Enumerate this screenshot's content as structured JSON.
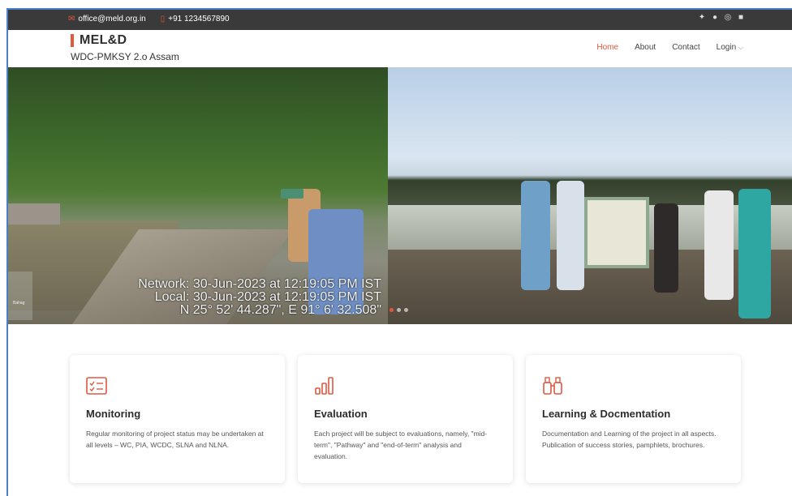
{
  "topbar": {
    "email": "office@meld.org.in",
    "phone": "+91 1234567890",
    "email_icon": "mail-icon",
    "phone_icon": "phone-icon",
    "social": [
      "twitter-icon",
      "facebook-icon",
      "instagram-icon",
      "linkedin-icon"
    ]
  },
  "brand": {
    "logo": "MEL&D",
    "subtitle": "WDC-PMKSY 2.o Assam"
  },
  "nav": {
    "home": "Home",
    "about": "About",
    "contact": "Contact",
    "login": "Login"
  },
  "hero": {
    "stamp_line1": "Network: 30-Jun-2023 at 12:19:05 PM IST",
    "stamp_line2": "Local: 30-Jun-2023 at 12:19:05 PM IST",
    "stamp_line3": "N 25° 52' 44.287\", E 91° 6' 32.508\"",
    "tiny_label": "Bahag"
  },
  "cards": [
    {
      "icon": "checklist-icon",
      "title": "Monitoring",
      "text": "Regular monitoring of project status may be undertaken at all levels – WC, PIA, WCDC, SLNA and NLNA."
    },
    {
      "icon": "bar-chart-icon",
      "title": "Evaluation",
      "text": "Each project will be subject to evaluations, namely, \"mid-term\", \"Pathway\" and \"end-of-term\" analysis and evaluation."
    },
    {
      "icon": "binoculars-icon",
      "title": "Learning & Docmentation",
      "text": "Documentation and Learning of the project in all aspects. Publication of success stories, pamphlets, brochures."
    }
  ],
  "colors": {
    "accent": "#e0583f",
    "topbar": "#3a3a3a"
  }
}
